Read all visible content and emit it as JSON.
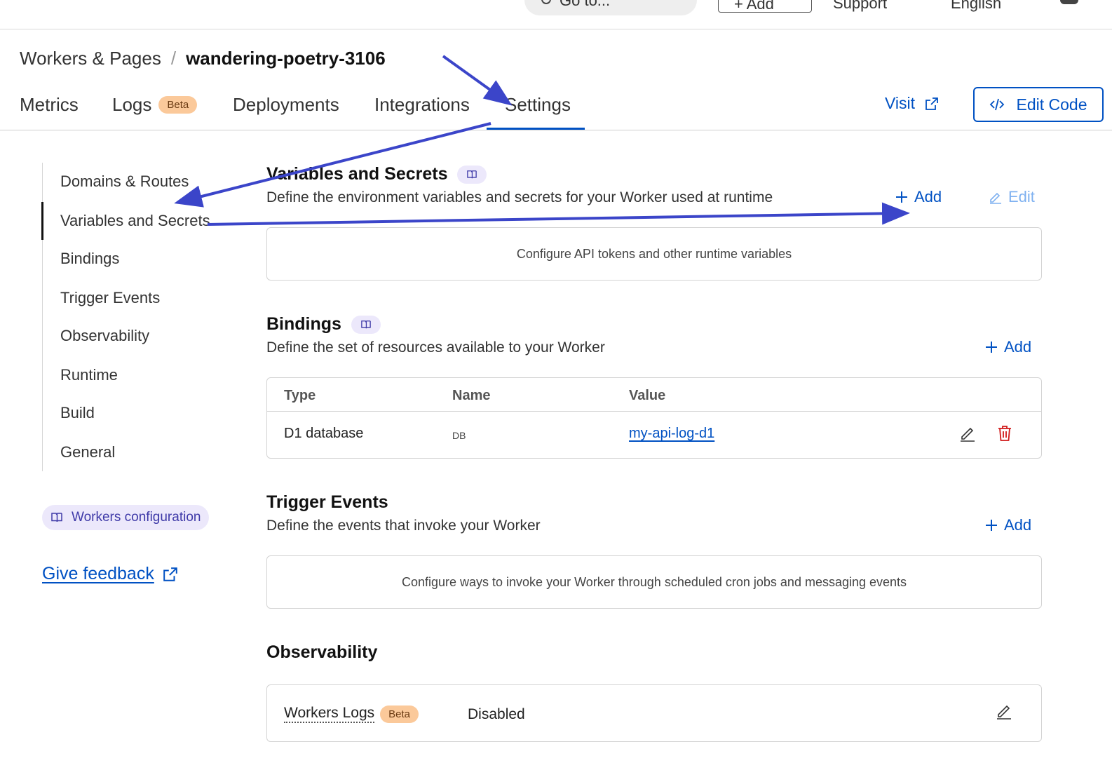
{
  "topbar": {
    "goto_label": "Go to...",
    "add_label": "+ Add",
    "support_label": "Support",
    "language_label": "English"
  },
  "breadcrumb": {
    "parent": "Workers & Pages",
    "separator": "/",
    "current": "wandering-poetry-3106"
  },
  "tabs": [
    {
      "label": "Metrics"
    },
    {
      "label": "Logs",
      "badge": "Beta"
    },
    {
      "label": "Deployments"
    },
    {
      "label": "Integrations"
    },
    {
      "label": "Settings",
      "active": true
    }
  ],
  "header_actions": {
    "visit_label": "Visit",
    "edit_code_label": "Edit Code"
  },
  "sidenav": {
    "items": [
      {
        "label": "Domains & Routes"
      },
      {
        "label": "Variables and Secrets",
        "active": true
      },
      {
        "label": "Bindings"
      },
      {
        "label": "Trigger Events"
      },
      {
        "label": "Observability"
      },
      {
        "label": "Runtime"
      },
      {
        "label": "Build"
      },
      {
        "label": "General"
      }
    ],
    "workers_config_label": "Workers configuration",
    "feedback_label": "Give feedback"
  },
  "sections": {
    "variables": {
      "title": "Variables and Secrets",
      "description": "Define the environment variables and secrets for your Worker used at runtime",
      "add_label": "Add",
      "edit_label": "Edit",
      "empty_text": "Configure API tokens and other runtime variables"
    },
    "bindings": {
      "title": "Bindings",
      "description": "Define the set of resources available to your Worker",
      "add_label": "Add",
      "columns": [
        "Type",
        "Name",
        "Value"
      ],
      "rows": [
        {
          "type": "D1 database",
          "name": "DB",
          "value": "my-api-log-d1"
        }
      ]
    },
    "triggers": {
      "title": "Trigger Events",
      "description": "Define the events that invoke your Worker",
      "add_label": "Add",
      "empty_text": "Configure ways to invoke your Worker through scheduled cron jobs and messaging events"
    },
    "observability": {
      "title": "Observability",
      "workers_logs_label": "Workers Logs",
      "badge": "Beta",
      "status": "Disabled"
    }
  },
  "colors": {
    "accent": "#0051c3",
    "beta_badge": "#fbc99a",
    "delete": "#d11a1a",
    "annotation_arrow": "#3b45c9",
    "doc_pill": "#ece8fb"
  }
}
